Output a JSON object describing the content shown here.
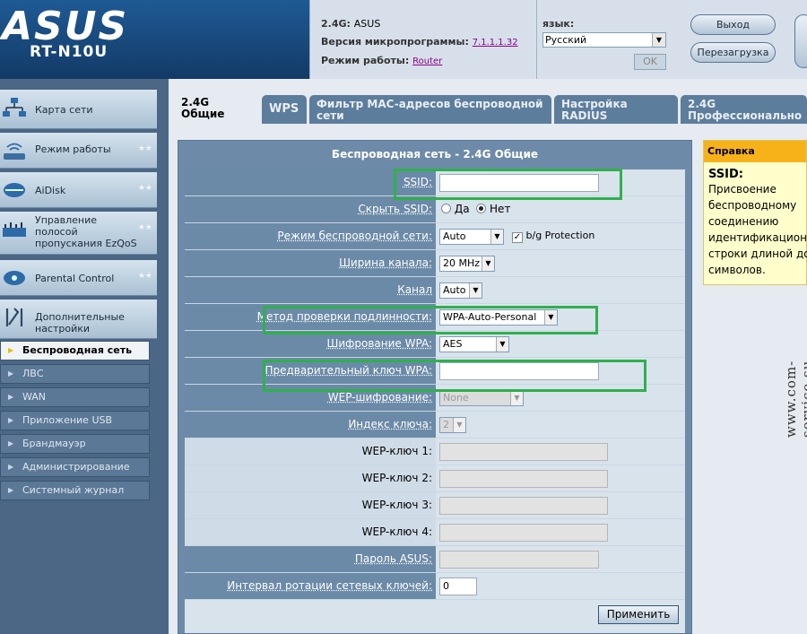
{
  "header": {
    "brand": "ASUS",
    "model": "RT-N10U",
    "band_label": "2.4G:",
    "band_value": "ASUS",
    "firmware_label": "Версия микропрограммы:",
    "firmware_value": "7.1.1.1.32",
    "mode_label": "Режим работы:",
    "mode_value": "Router",
    "lang_label": "язык:",
    "lang_value": "Русский",
    "ok_label": "OK",
    "logout_label": "Выход",
    "reboot_label": "Перезагрузка"
  },
  "sidebar": {
    "items": [
      {
        "label": "Карта сети"
      },
      {
        "label": "Режим работы"
      },
      {
        "label": "AiDisk"
      },
      {
        "label": "Управление полосой пропускания EzQoS"
      },
      {
        "label": "Parental Control"
      },
      {
        "label": "Дополнительные настройки"
      }
    ],
    "sub_items": [
      {
        "label": "Беспроводная сеть"
      },
      {
        "label": "ЛВС"
      },
      {
        "label": "WAN"
      },
      {
        "label": "Приложение USB"
      },
      {
        "label": "Брандмауэр"
      },
      {
        "label": "Администрирование"
      },
      {
        "label": "Системный журнал"
      }
    ]
  },
  "tabs": [
    {
      "label": "2.4G Общие"
    },
    {
      "label": "WPS"
    },
    {
      "label": "Фильтр MAC-адресов беспроводной сети"
    },
    {
      "label": "Настройка RADIUS"
    },
    {
      "label": "2.4G Профессионально"
    }
  ],
  "form": {
    "title": "Беспроводная сеть - 2.4G Общие",
    "ssid_label": "SSID:",
    "ssid_value": "",
    "hide_ssid_label": "Скрыть SSID:",
    "hide_ssid_yes": "Да",
    "hide_ssid_no": "Нет",
    "mode_label": "Режим беспроводной сети:",
    "mode_value": "Auto",
    "bg_protection_label": "b/g Protection",
    "channel_width_label": "Ширина канала:",
    "channel_width_value": "20 MHz",
    "channel_label": "Канал",
    "channel_value": "Auto",
    "auth_label": "Метод проверки подлинности:",
    "auth_value": "WPA-Auto-Personal",
    "wpa_enc_label": "Шифрование WPA:",
    "wpa_enc_value": "AES",
    "wpa_key_label": "Предварительный ключ WPA:",
    "wpa_key_value": "",
    "wep_enc_label": "WEP-шифрование:",
    "wep_enc_value": "None",
    "key_index_label": "Индекс ключа:",
    "key_index_value": "2",
    "wep_key1_label": "WEP-ключ 1:",
    "wep_key2_label": "WEP-ключ 2:",
    "wep_key3_label": "WEP-ключ 3:",
    "wep_key4_label": "WEP-ключ 4:",
    "asus_pass_label": "Пароль ASUS:",
    "rotation_label": "Интервал ротации сетевых ключей:",
    "rotation_value": "0",
    "apply_label": "Применить"
  },
  "help": {
    "title": "Справка",
    "heading": "SSID:",
    "lines": [
      "Присвоение",
      "беспроводному",
      "соединению",
      "идентификацион",
      "строки длиной до",
      "символов."
    ]
  },
  "watermark": "www.com-service.su",
  "colors": {
    "highlight": "#2fb04d",
    "help_title": "#f7b21a",
    "panel": "#6b8aa7"
  }
}
